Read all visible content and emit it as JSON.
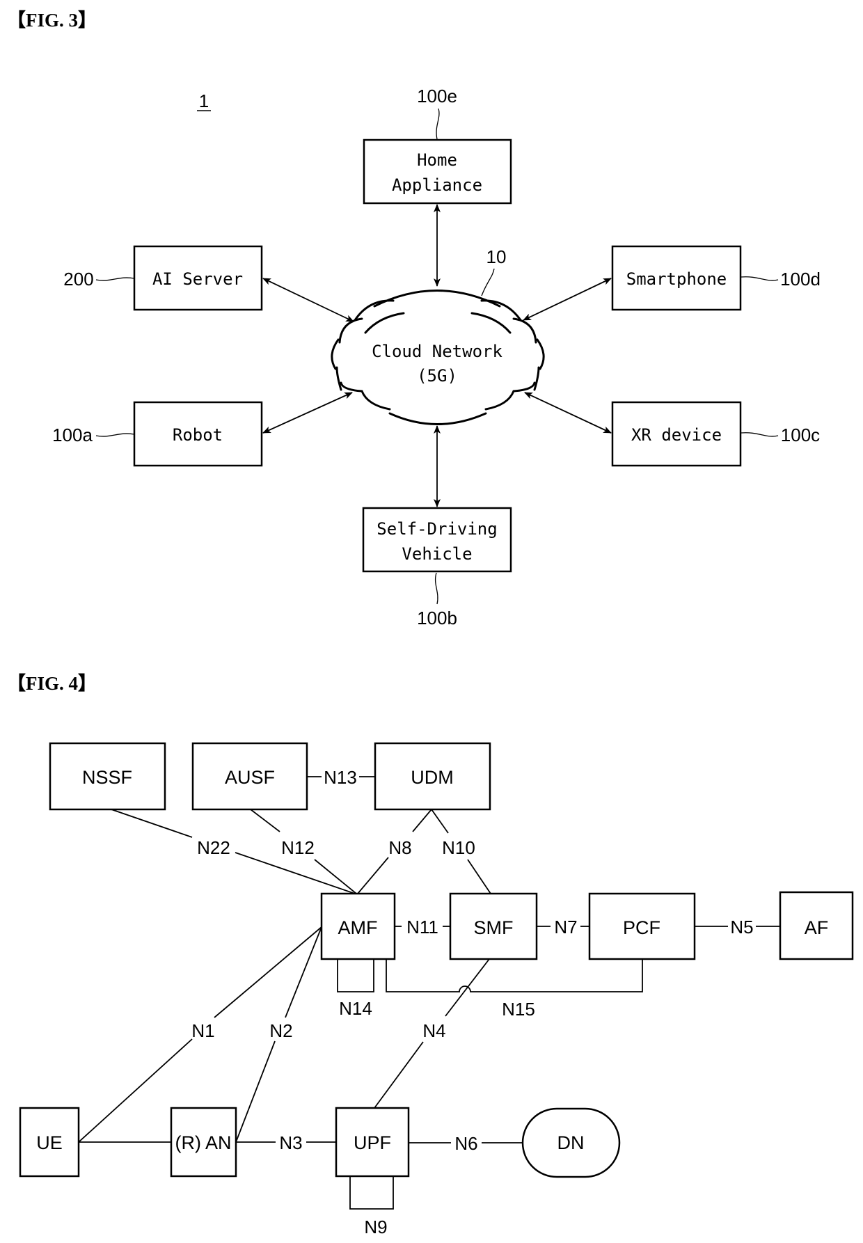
{
  "fig3": {
    "title": "【FIG. 3】",
    "system_ref": "1",
    "cloud": {
      "line1": "Cloud Network",
      "line2": "(5G)",
      "ref": "10"
    },
    "nodes": [
      {
        "id": "home-appliance",
        "line1": "Home",
        "line2": "Appliance",
        "ref": "100e"
      },
      {
        "id": "ai-server",
        "line1": "AI Server",
        "line2": "",
        "ref": "200"
      },
      {
        "id": "smartphone",
        "line1": "Smartphone",
        "line2": "",
        "ref": "100d"
      },
      {
        "id": "robot",
        "line1": "Robot",
        "line2": "",
        "ref": "100a"
      },
      {
        "id": "xr-device",
        "line1": "XR device",
        "line2": "",
        "ref": "100c"
      },
      {
        "id": "self-driving-vehicle",
        "line1": "Self-Driving",
        "line2": "Vehicle",
        "ref": "100b"
      }
    ]
  },
  "fig4": {
    "title": "【FIG. 4】",
    "functions": {
      "nssf": "NSSF",
      "ausf": "AUSF",
      "udm": "UDM",
      "amf": "AMF",
      "smf": "SMF",
      "pcf": "PCF",
      "af": "AF",
      "ue": "UE",
      "ran": "(R) AN",
      "upf": "UPF",
      "dn": "DN"
    },
    "interfaces": {
      "n1": "N1",
      "n2": "N2",
      "n3": "N3",
      "n4": "N4",
      "n5": "N5",
      "n6": "N6",
      "n7": "N7",
      "n8": "N8",
      "n9": "N9",
      "n10": "N10",
      "n11": "N11",
      "n12": "N12",
      "n13": "N13",
      "n14": "N14",
      "n15": "N15",
      "n22": "N22"
    }
  }
}
